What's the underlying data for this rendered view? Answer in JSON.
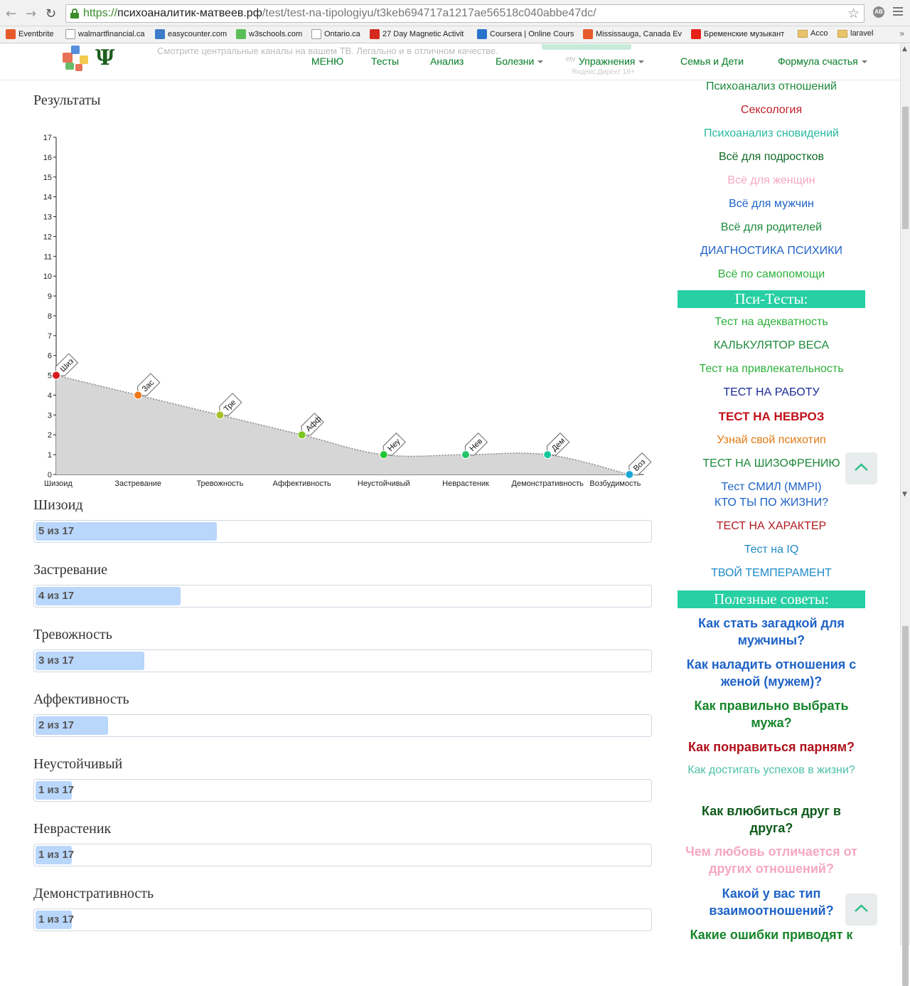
{
  "browser": {
    "url_scheme": "https://",
    "url_host": "психоаналитик-матвеев.рф",
    "url_path": "/test/test-na-tipologiyu/t3keb694717a1217ae56518c040abbe47dc/",
    "bookmarks": [
      {
        "label": "Eventbrite",
        "icon": "eventbrite-icon",
        "color": "#e65a2b"
      },
      {
        "label": "walmartfinancial.ca",
        "icon": "page-icon",
        "color": "#ffffff"
      },
      {
        "label": "easycounter.com",
        "icon": "easycounter-icon",
        "color": "#3d7cc9"
      },
      {
        "label": "w3schools.com",
        "icon": "w3schools-icon",
        "color": "#5bbd56"
      },
      {
        "label": "Ontario.ca",
        "icon": "ontario-icon",
        "color": "#ffffff"
      },
      {
        "label": "27 Day Magnetic Activit",
        "icon": "maple-leaf-icon",
        "color": "#d52b1e"
      },
      {
        "label": "Coursera | Online Cours",
        "icon": "coursera-icon",
        "color": "#2a73cc"
      },
      {
        "label": "Mississauga, Canada Ev",
        "icon": "eventbrite-icon",
        "color": "#e65a2b"
      },
      {
        "label": "Бременские музыкант",
        "icon": "youtube-icon",
        "color": "#e62117"
      },
      {
        "label": "Acco",
        "icon": "folder-icon",
        "color": "#e8c56a"
      },
      {
        "label": "laravel",
        "icon": "folder-icon",
        "color": "#e8c56a"
      }
    ]
  },
  "header": {
    "ad_text": "Смотрите центральные каналы на вашем ТВ. Легально и в отличном качестве.",
    "ad_small": "etv",
    "ad_small2": "Яндекс.Директ 18+",
    "nav": [
      {
        "label": "МЕНЮ",
        "caret": false
      },
      {
        "label": "Тесты",
        "caret": false
      },
      {
        "label": "Анализ",
        "caret": false
      },
      {
        "label": "Болезни",
        "caret": true
      },
      {
        "label": "Упражнения",
        "caret": true
      },
      {
        "label": "Семья и Дети",
        "caret": false
      },
      {
        "label": "Формула счастья",
        "caret": true
      }
    ]
  },
  "main": {
    "results_title": "Результаты",
    "scales": [
      {
        "label": "Шизоид",
        "value": 5,
        "max": 17,
        "text": "5 из 17"
      },
      {
        "label": "Застревание",
        "value": 4,
        "max": 17,
        "text": "4 из 17"
      },
      {
        "label": "Тревожность",
        "value": 3,
        "max": 17,
        "text": "3 из 17"
      },
      {
        "label": "Аффективность",
        "value": 2,
        "max": 17,
        "text": "2 из 17"
      },
      {
        "label": "Неустойчивый",
        "value": 1,
        "max": 17,
        "text": "1 из 17"
      },
      {
        "label": "Неврастеник",
        "value": 1,
        "max": 17,
        "text": "1 из 17"
      },
      {
        "label": "Демонстративность",
        "value": 1,
        "max": 17,
        "text": "1 из 17"
      }
    ]
  },
  "chart_data": {
    "type": "area",
    "categories": [
      "Шизоид",
      "Застревание",
      "Тревожность",
      "Аффективность",
      "Неустойчивый",
      "Неврастеник",
      "Демонстративность",
      "Возбудимость"
    ],
    "values": [
      5,
      4,
      3,
      2,
      1,
      1,
      1,
      0
    ],
    "point_labels": [
      "Шиз",
      "Зас",
      "Тре",
      "Афф",
      "Неу",
      "Нев",
      "Дем",
      "Воз"
    ],
    "point_colors": [
      "#d7191c",
      "#f07818",
      "#a8c12a",
      "#7bc61f",
      "#22c432",
      "#22c466",
      "#16c69a",
      "#1aa7d6"
    ],
    "ylim": [
      0,
      17
    ],
    "yticks": [
      0,
      1,
      2,
      3,
      4,
      5,
      6,
      7,
      8,
      9,
      10,
      11,
      12,
      13,
      14,
      15,
      16,
      17
    ],
    "title": "",
    "xlabel": "",
    "ylabel": ""
  },
  "sidebar": {
    "top_links": [
      {
        "label": "Психоанализ отношений",
        "color": "#1e8a3c"
      },
      {
        "label": "Сексология",
        "color": "#c0202a"
      },
      {
        "label": "Психоанализ сновидений",
        "color": "#27b8a0"
      },
      {
        "label": "Всё для подростков",
        "color": "#116b28"
      },
      {
        "label": "Всё для женщин",
        "color": "#f5a8c0"
      },
      {
        "label": "Всё для мужчин",
        "color": "#1f63c7"
      },
      {
        "label": "Всё для родителей",
        "color": "#1e8a3c"
      },
      {
        "label": "ДИАГНОСТИКА ПСИХИКИ",
        "color": "#1f63c7"
      },
      {
        "label": "Всё по самопомощи",
        "color": "#2bb03a"
      }
    ],
    "tests_heading": "Пси-Тесты:",
    "tests": [
      {
        "label": "Тест на адекватность",
        "color": "#2bb03a",
        "bold": false
      },
      {
        "label": "КАЛЬКУЛЯТОР ВЕСА",
        "color": "#1e8a3c",
        "bold": false
      },
      {
        "label": "Тест на привлекательность",
        "color": "#2bb03a",
        "bold": false
      },
      {
        "label": "ТЕСТ НА РАБОТУ",
        "color": "#1a2a9a",
        "bold": false
      },
      {
        "label": "ТЕСТ НА НЕВРОЗ",
        "color": "#c0101a",
        "bold": true
      },
      {
        "label": "Узнай свой психотип",
        "color": "#e07a12",
        "bold": false
      },
      {
        "label": "ТЕСТ НА ШИЗОФРЕНИЮ",
        "color": "#1e8a3c",
        "bold": false
      },
      {
        "label": "Тест СМИЛ (MMPI)",
        "color": "#1f63c7",
        "bold": false
      },
      {
        "label": "КТО ТЫ ПО ЖИЗНИ?",
        "color": "#1f63c7",
        "bold": false
      },
      {
        "label": "ТЕСТ НА ХАРАКТЕР",
        "color": "#b01a20",
        "bold": false
      },
      {
        "label": "Тест на IQ",
        "color": "#1f8ac7",
        "bold": false
      },
      {
        "label": "ТВОЙ ТЕМПЕРАМЕНТ",
        "color": "#1f8ac7",
        "bold": false
      }
    ],
    "tips_heading": "Полезные советы:",
    "tips": [
      {
        "label": "Как стать загадкой для мужчины?",
        "color": "#1f63c7",
        "bold": true
      },
      {
        "label": "Как наладить отношения с женой (мужем)?",
        "color": "#1f63c7",
        "bold": true
      },
      {
        "label": "Как правильно выбрать мужа?",
        "color": "#16852a",
        "bold": true
      },
      {
        "label": "Как понравиться парням?",
        "color": "#b0101a",
        "bold": true
      },
      {
        "label": "Как достигать успехов в жизни?",
        "color": "#4bbfa8",
        "bold": false
      },
      {
        "label": "Как влюбиться друг в друга?",
        "color": "#0d5a1a",
        "bold": true
      },
      {
        "label": "Чем любовь отличается от других отношений?",
        "color": "#f5a8c0",
        "bold": true
      },
      {
        "label": "Какой у вас тип взаимоотношений?",
        "color": "#1f63c7",
        "bold": true
      },
      {
        "label": "Какие ошибки приводят к",
        "color": "#16852a",
        "bold": true
      }
    ]
  }
}
